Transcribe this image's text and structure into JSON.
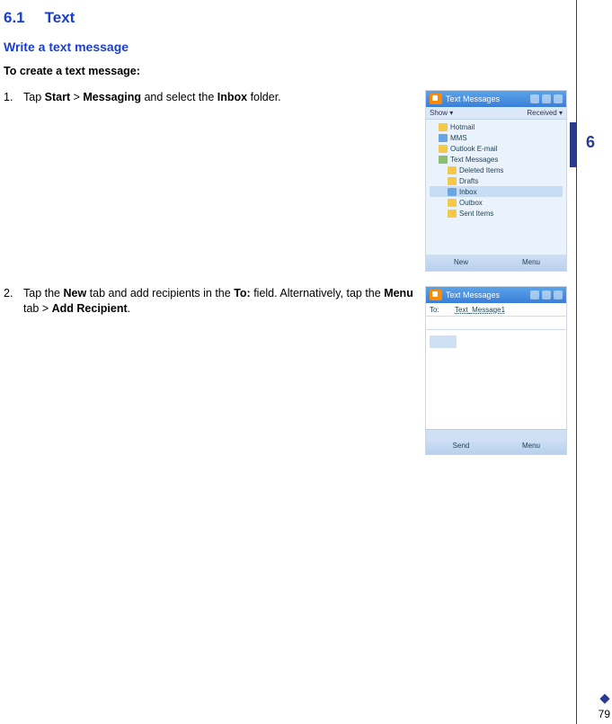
{
  "section": {
    "number": "6.1",
    "title": "Text"
  },
  "subsection": "Write a text message",
  "lead": "To create a text message:",
  "steps": [
    {
      "n": "1.",
      "parts": [
        {
          "t": "Tap "
        },
        {
          "t": "Start",
          "b": true
        },
        {
          "t": " > "
        },
        {
          "t": "Messaging",
          "b": true
        },
        {
          "t": " and select the "
        },
        {
          "t": "Inbox",
          "b": true
        },
        {
          "t": " folder."
        }
      ]
    },
    {
      "n": "2.",
      "parts": [
        {
          "t": "Tap the "
        },
        {
          "t": "New",
          "b": true
        },
        {
          "t": " tab and add recipients in the "
        },
        {
          "t": "To:",
          "b": true
        },
        {
          "t": " field. Alternatively, tap the "
        },
        {
          "t": "Menu",
          "b": true
        },
        {
          "t": " tab > "
        },
        {
          "t": "Add Recipient",
          "b": true
        },
        {
          "t": "."
        }
      ]
    }
  ],
  "shot1": {
    "title": "Text Messages",
    "subLeft": "Show ▾",
    "subRight": "Received ▾",
    "tree": [
      {
        "label": "Hotmail",
        "cls": "ind1",
        "ico": "y"
      },
      {
        "label": "MMS",
        "cls": "ind1",
        "ico": "b"
      },
      {
        "label": "Outlook E-mail",
        "cls": "ind1",
        "ico": "y"
      },
      {
        "label": "Text Messages",
        "cls": "ind1",
        "ico": "g"
      },
      {
        "label": "Deleted Items",
        "cls": "ind2",
        "ico": "y"
      },
      {
        "label": "Drafts",
        "cls": "ind2",
        "ico": "y"
      },
      {
        "label": "Inbox",
        "cls": "ind2 sel",
        "ico": "b"
      },
      {
        "label": "Outbox",
        "cls": "ind2",
        "ico": "y"
      },
      {
        "label": "Sent Items",
        "cls": "ind2",
        "ico": "y"
      }
    ],
    "softLeft": "New",
    "softRight": "Menu"
  },
  "shot2": {
    "title": "Text Messages",
    "toLabel": "To:",
    "toValue": "Text_Message1",
    "softLeft": "Send",
    "softRight": "Menu"
  },
  "chapter": "6",
  "pageNumber": "79"
}
